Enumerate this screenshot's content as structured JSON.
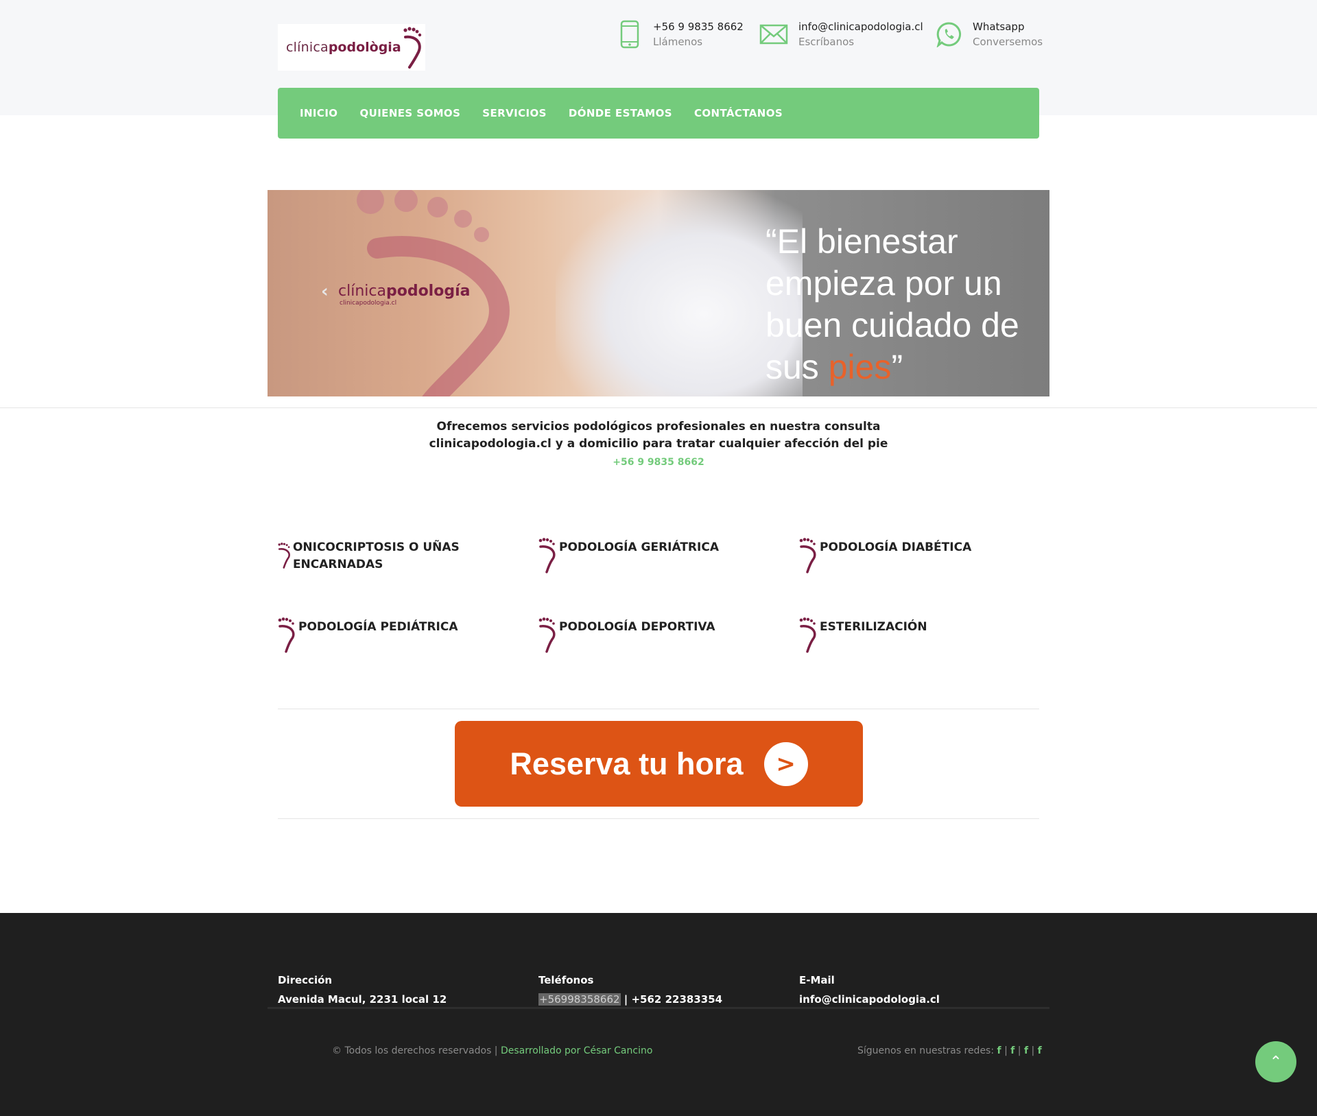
{
  "logo": {
    "part1": "clínica",
    "part2": "podològia"
  },
  "header": {
    "phone": {
      "value": "+56 9 9835 8662",
      "caption": "Llámenos"
    },
    "email": {
      "value": "info@clinicapodologia.cl",
      "caption": "Escríbanos"
    },
    "whatsapp": {
      "value": "Whatsapp",
      "caption": "Conversemos"
    }
  },
  "nav": [
    "INICIO",
    "QUIENES SOMOS",
    "SERVICIOS",
    "DÓNDE ESTAMOS",
    "CONTÁCTANOS"
  ],
  "slider": {
    "brand1": "clínica",
    "brand2": "podología",
    "brand_sub": "clinicapodologia.cl",
    "quote_a": "“El bienestar empieza por un buen cuidado de sus ",
    "quote_hl": "pies",
    "quote_b": "”",
    "prev": "‹",
    "next": "›"
  },
  "intro": {
    "line1": "Ofrecemos servicios podológicos profesionales en nuestra consulta",
    "line2": "clinicapodologia.cl y a domicilio para tratar cualquier afección del pie",
    "phone": "+56 9 9835 8662"
  },
  "services": [
    "ONICOCRIPTOSIS O UÑAS ENCARNADAS",
    "PODOLOGÍA GERIÁTRICA",
    "PODOLOGÍA DIABÉTICA",
    "PODOLOGÍA PEDIÁTRICA",
    "PODOLOGÍA DEPORTIVA",
    "ESTERILIZACIÓN"
  ],
  "cta": {
    "label": "Reserva tu hora",
    "arrow": ">"
  },
  "footer": {
    "address_title": "Dirección",
    "address": "Avenida Macul, 2231 local 12",
    "phones_title": "Teléfonos",
    "phone1": "+56998358662",
    "phone_sep": " | ",
    "phone2": "+562 22383354",
    "email_title": "E-Mail",
    "email": "info@clinicapodologia.cl",
    "copyright": "© Todos los derechos reservados | ",
    "developer": "Desarrollado por César Cancino",
    "social_label": "Síguenos en nuestras redes: ",
    "social_icons": [
      "f",
      "f",
      "f",
      "f"
    ],
    "social_sep": "|"
  },
  "to_top": "⌃",
  "colors": {
    "green": "#74cb7c",
    "orange": "#dd5415",
    "brand": "#7a1f44",
    "footer_bg": "#1f1f1f"
  }
}
